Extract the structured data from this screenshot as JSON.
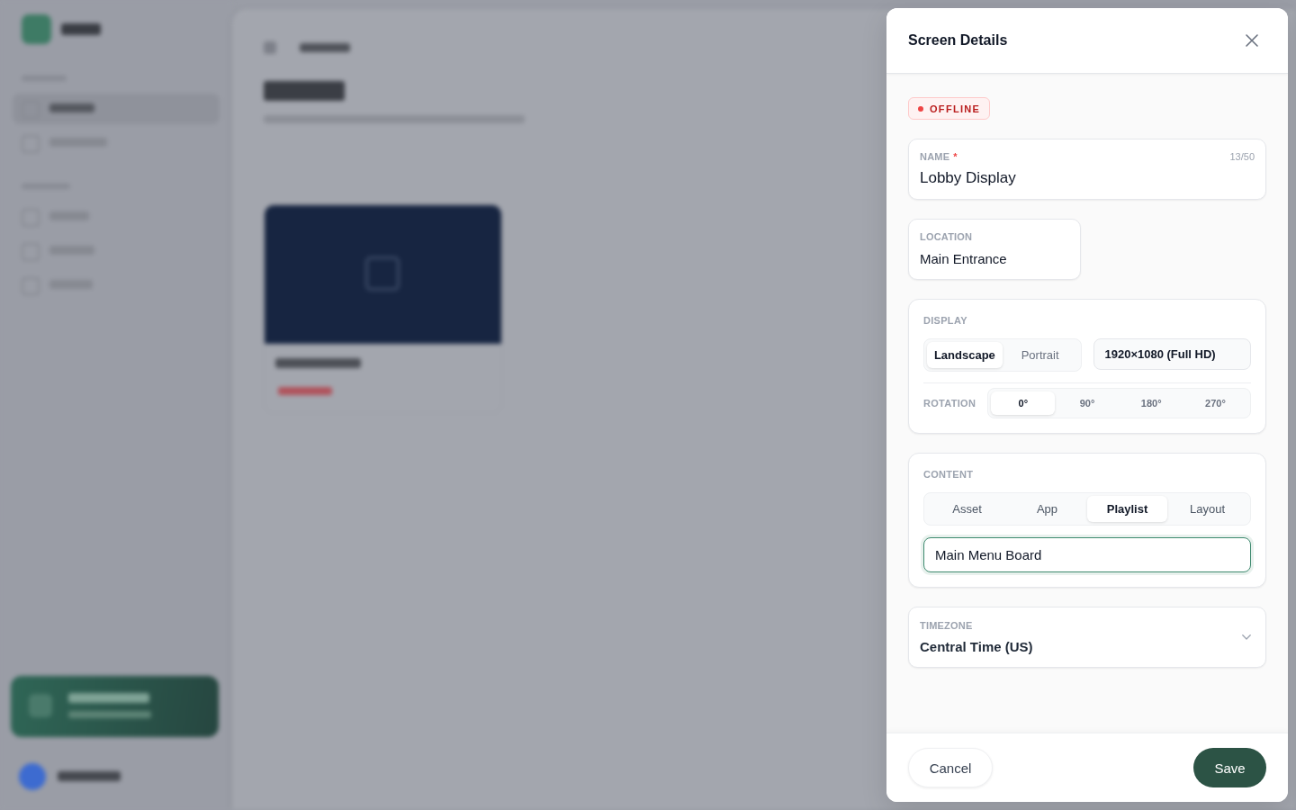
{
  "panel": {
    "title": "Screen Details"
  },
  "status": {
    "label": "OFFLINE",
    "kind": "offline"
  },
  "name_field": {
    "label": "NAME",
    "required_mark": "*",
    "counter": "13/50",
    "value": "Lobby Display"
  },
  "location_field": {
    "label": "LOCATION",
    "value": "Main Entrance"
  },
  "display": {
    "heading": "DISPLAY",
    "orientation_options": [
      {
        "label": "Landscape",
        "selected": true
      },
      {
        "label": "Portrait",
        "selected": false
      }
    ],
    "resolution": "1920×1080 (Full HD)",
    "rotation": {
      "label": "ROTATION",
      "options": [
        {
          "label": "0°",
          "selected": true
        },
        {
          "label": "90°",
          "selected": false
        },
        {
          "label": "180°",
          "selected": false
        },
        {
          "label": "270°",
          "selected": false
        }
      ]
    }
  },
  "content": {
    "heading": "CONTENT",
    "tabs": [
      {
        "label": "Asset",
        "selected": false
      },
      {
        "label": "App",
        "selected": false
      },
      {
        "label": "Playlist",
        "selected": true
      },
      {
        "label": "Layout",
        "selected": false
      }
    ],
    "selection": {
      "value": "Main Menu Board",
      "focused": true
    }
  },
  "timezone": {
    "label": "TIMEZONE",
    "value": "Central Time (US)"
  },
  "footer": {
    "buttons": [
      {
        "label": "Cancel",
        "kind": "secondary"
      },
      {
        "label": "Save",
        "kind": "primary"
      }
    ]
  }
}
